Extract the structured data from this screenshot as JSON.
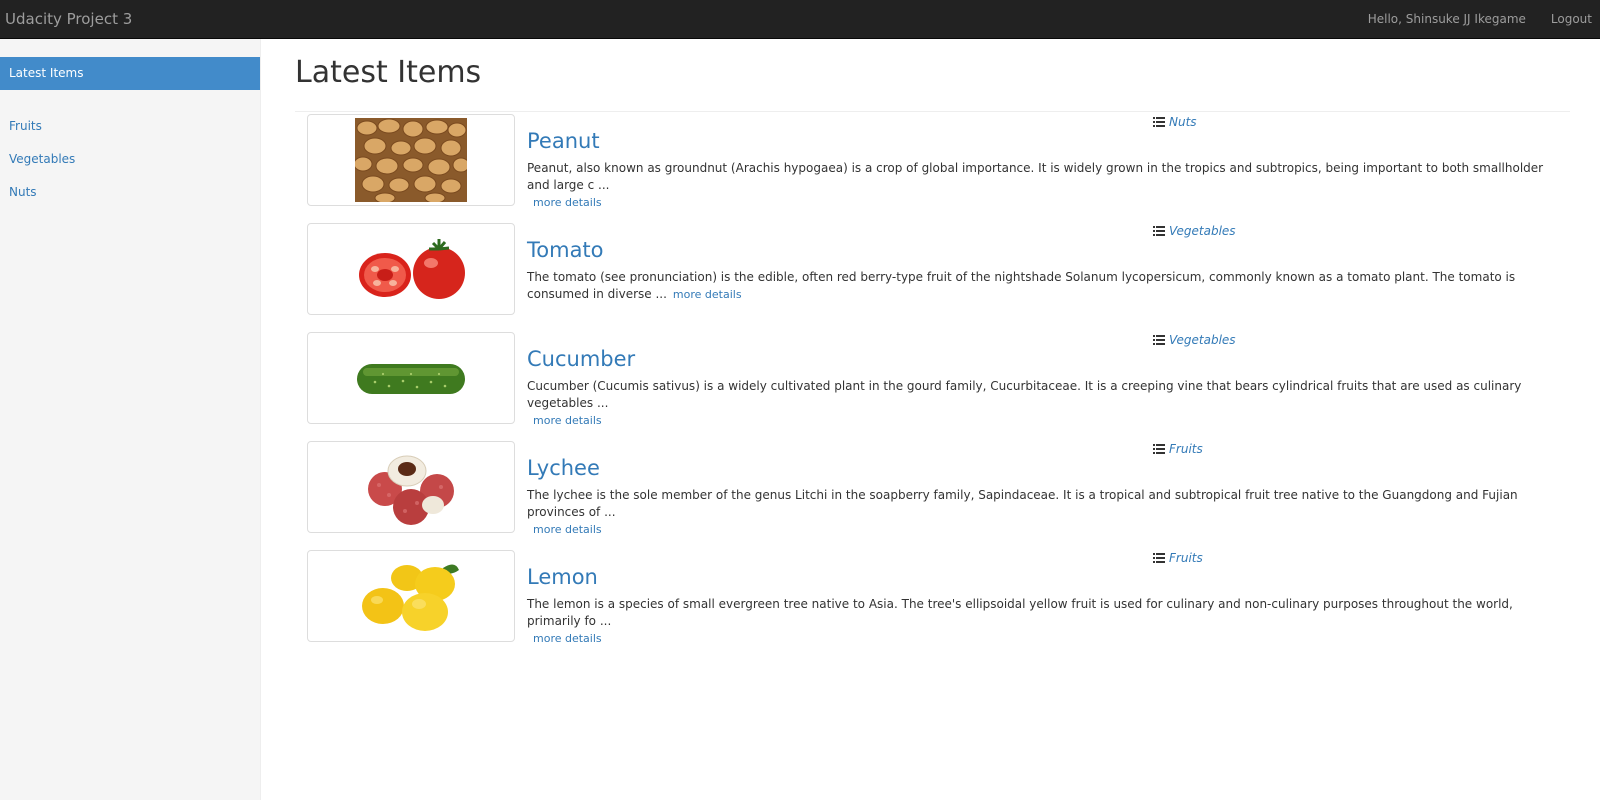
{
  "navbar": {
    "brand": "Udacity Project 3",
    "greeting": "Hello, Shinsuke JJ Ikegame",
    "logout": "Logout"
  },
  "sidebar": {
    "active": "Latest Items",
    "items": [
      {
        "label": "Fruits"
      },
      {
        "label": "Vegetables"
      },
      {
        "label": "Nuts"
      }
    ]
  },
  "main": {
    "title": "Latest Items",
    "more_label": "more details",
    "items": [
      {
        "name": "Peanut",
        "category": "Nuts",
        "description": "Peanut, also known as groundnut (Arachis hypogaea) is a crop of global importance. It is widely grown in the tropics and subtropics, being important to both smallholder and large c ...",
        "image": "peanut-image"
      },
      {
        "name": "Tomato",
        "category": "Vegetables",
        "description": "The tomato (see pronunciation) is the edible, often red berry-type fruit of the nightshade Solanum lycopersicum, commonly known as a tomato plant. The tomato is consumed in diverse ...",
        "image": "tomato-image"
      },
      {
        "name": "Cucumber",
        "category": "Vegetables",
        "description": "Cucumber (Cucumis sativus) is a widely cultivated plant in the gourd family, Cucurbitaceae. It is a creeping vine that bears cylindrical fruits that are used as culinary vegetables ...",
        "image": "cucumber-image"
      },
      {
        "name": "Lychee",
        "category": "Fruits",
        "description": "The lychee is the sole member of the genus Litchi in the soapberry family, Sapindaceae. It is a tropical and subtropical fruit tree native to the Guangdong and Fujian provinces of ...",
        "image": "lychee-image"
      },
      {
        "name": "Lemon",
        "category": "Fruits",
        "description": "The lemon is a species of small evergreen tree native to Asia. The tree's ellipsoidal yellow fruit is used for culinary and non-culinary purposes throughout the world, primarily fo ...",
        "image": "lemon-image"
      }
    ]
  },
  "colors": {
    "navbar_bg": "#222222",
    "link": "#337ab7",
    "active_bg": "#428bca",
    "sidebar_bg": "#f5f5f5"
  },
  "icons": {
    "category": "list-icon"
  }
}
